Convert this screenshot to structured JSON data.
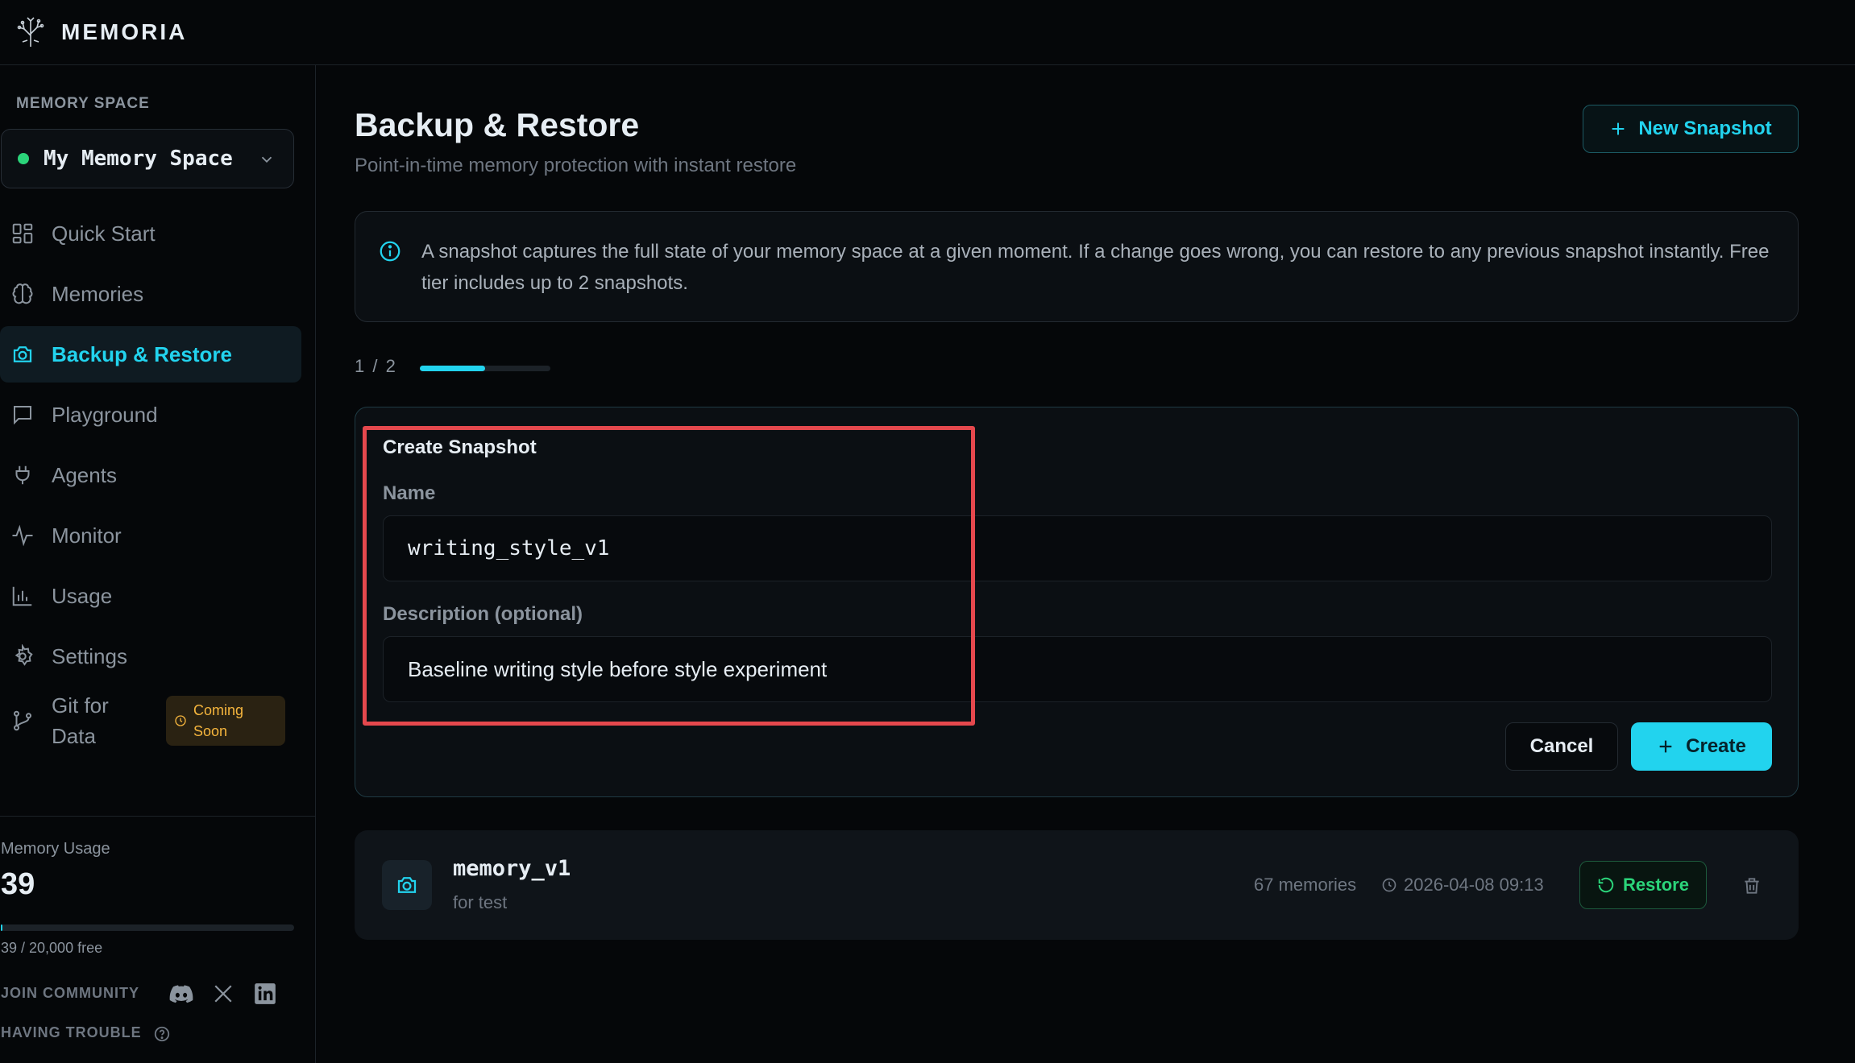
{
  "app": {
    "name": "MEMORIA"
  },
  "sidebar": {
    "memory_space_label": "MEMORY SPACE",
    "memory_space_name": "My Memory Space",
    "items": [
      {
        "label": "Quick Start",
        "icon": "grid-icon"
      },
      {
        "label": "Memories",
        "icon": "brain-icon"
      },
      {
        "label": "Backup & Restore",
        "icon": "camera-icon",
        "active": true
      },
      {
        "label": "Playground",
        "icon": "chat-icon"
      },
      {
        "label": "Agents",
        "icon": "plug-icon"
      },
      {
        "label": "Monitor",
        "icon": "activity-icon"
      },
      {
        "label": "Usage",
        "icon": "bar-chart-icon"
      },
      {
        "label": "Settings",
        "icon": "gear-icon"
      },
      {
        "label": "Git for Data",
        "icon": "git-branch-icon",
        "badge": "Coming Soon"
      }
    ],
    "memory_usage": {
      "label": "Memory Usage",
      "value": "39",
      "detail": "39 / 20,000 free",
      "fraction": 0.00195
    },
    "join_community": "JOIN COMMUNITY",
    "having_trouble": "HAVING TROUBLE",
    "socials": [
      "discord-icon",
      "x-icon",
      "linkedin-icon"
    ]
  },
  "main": {
    "title": "Backup & Restore",
    "subtitle": "Point-in-time memory protection with instant restore",
    "new_snapshot_label": "New Snapshot",
    "info_text": "A snapshot captures the full state of your memory space at a given moment. If a change goes wrong, you can restore to any previous snapshot instantly. Free tier includes up to 2 snapshots.",
    "pager": {
      "text": "1 / 2",
      "current": 1,
      "total": 2
    },
    "create_form": {
      "title": "Create Snapshot",
      "name_label": "Name",
      "name_value": "writing_style_v1",
      "description_label": "Description (optional)",
      "description_value": "Baseline writing style before style experiment",
      "cancel_label": "Cancel",
      "create_label": "Create"
    },
    "snapshots": [
      {
        "name": "memory_v1",
        "description": "for test",
        "memories": "67 memories",
        "timestamp": "2026-04-08 09:13",
        "restore_label": "Restore"
      }
    ]
  },
  "colors": {
    "accent": "#22d3ee",
    "success": "#2bd47a",
    "warning": "#f5b53d",
    "highlight": "#e5484d",
    "background": "#050709"
  }
}
